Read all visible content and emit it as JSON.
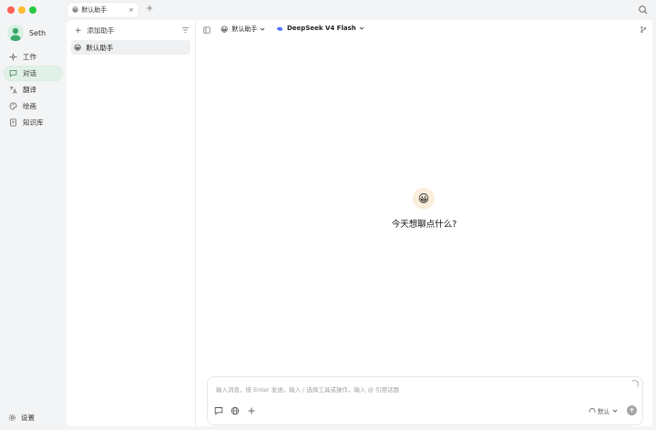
{
  "colors": {
    "traffic_red": "#fe5f57",
    "traffic_yellow": "#febc2e",
    "traffic_green": "#28c840",
    "accent_green": "#e1f1e7"
  },
  "tab": {
    "emoji": "😀",
    "label": "默认助手",
    "close": "×"
  },
  "new_tab": "+",
  "user": {
    "name": "Seth"
  },
  "nav": {
    "items": [
      {
        "icon": "work-icon",
        "label": "工作"
      },
      {
        "icon": "chat-bubble-icon",
        "label": "对话"
      },
      {
        "icon": "translate-icon",
        "label": "翻译"
      },
      {
        "icon": "palette-icon",
        "label": "绘画"
      },
      {
        "icon": "book-icon",
        "label": "知识库"
      }
    ],
    "settings_label": "设置"
  },
  "assistants": {
    "add_label": "添加助手",
    "add_symbol": "+",
    "items": [
      {
        "emoji": "😀",
        "label": "默认助手"
      }
    ]
  },
  "chat": {
    "assistant_emoji": "😀",
    "assistant_label": "默认助手",
    "model_label": "DeepSeek V4 Flash",
    "welcome_emoji": "😀",
    "welcome_text": "今天想聊点什么?",
    "input_placeholder": "输入消息，按 Enter 发送。输入 / 选择工具或操作，输入 @ 引用话题",
    "think_label": "默认"
  }
}
